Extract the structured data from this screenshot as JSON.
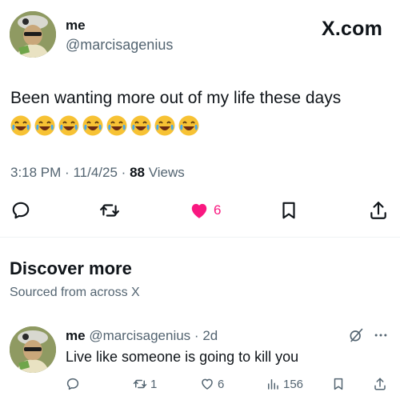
{
  "post": {
    "author_name": "me",
    "author_handle": "@marcisagenius",
    "brand": "X.com",
    "text": "Been wanting more out of my life these days",
    "emoji": "😂😂😂😂😂😂😂😂",
    "time": "3:18 PM",
    "separator": "·",
    "date": "11/4/25",
    "views_count": "88",
    "views_label": "Views",
    "actions": {
      "reply_icon": "reply-icon",
      "repost_icon": "repost-icon",
      "like_icon": "heart-filled-icon",
      "like_count": "6",
      "bookmark_icon": "bookmark-icon",
      "share_icon": "share-icon"
    },
    "like_color": "#f91880"
  },
  "discover": {
    "title": "Discover more",
    "subtitle": "Sourced from across X"
  },
  "related_post": {
    "author_name": "me",
    "author_handle": "@marcisagenius",
    "separator": "·",
    "age": "2d",
    "text": "Live like someone is going to kill you",
    "repost_count": "1",
    "like_count": "6",
    "views_count": "156"
  },
  "colors": {
    "text_primary": "#0f1419",
    "text_secondary": "#536471",
    "divider": "#eff3f4"
  }
}
